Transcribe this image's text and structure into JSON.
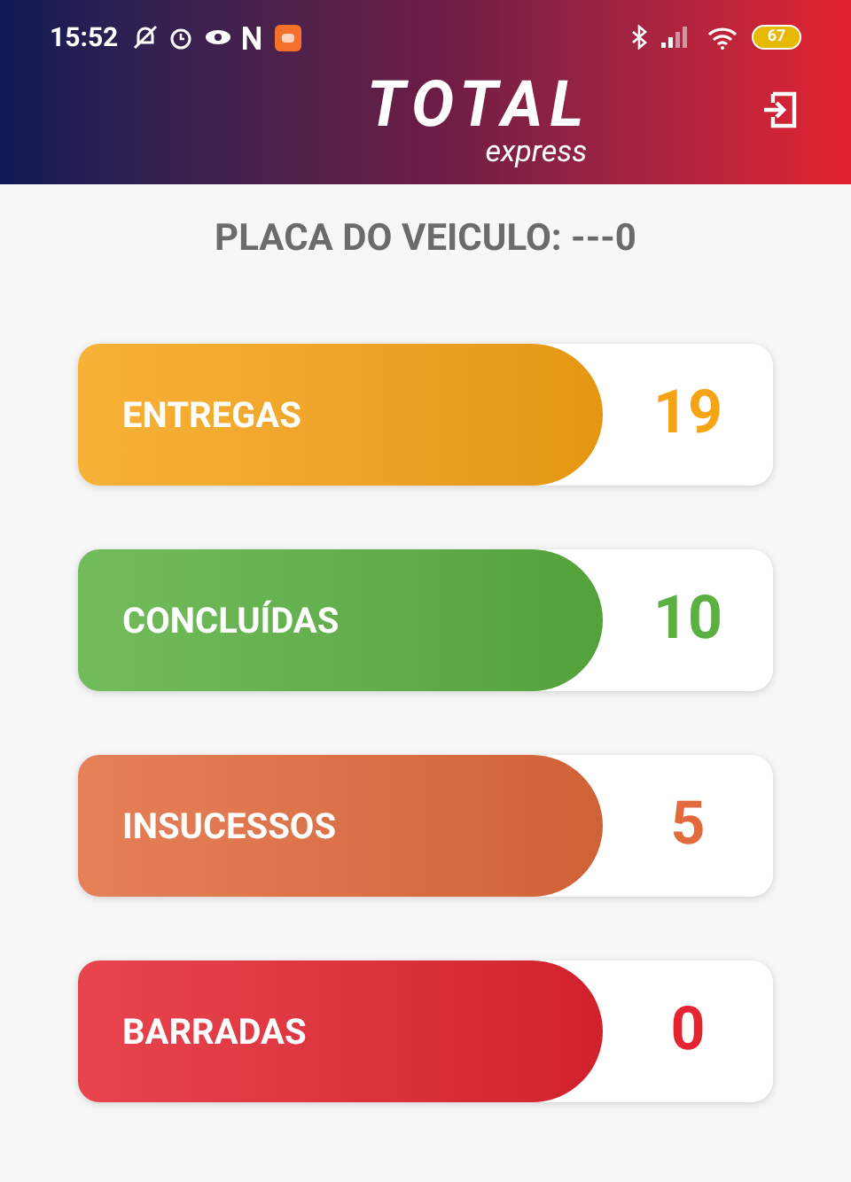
{
  "status_bar": {
    "time": "15:52",
    "battery": "67"
  },
  "header": {
    "logo": "TOTAL",
    "logo_sub": "express"
  },
  "plate": "PLACA DO VEICULO: ---0",
  "cards": [
    {
      "label": "ENTREGAS",
      "count": "19",
      "color": "#f7a414"
    },
    {
      "label": "CONCLUÍDAS",
      "count": "10",
      "color": "#5ab040"
    },
    {
      "label": "INSUCESSOS",
      "count": "5",
      "color": "#e26a3c"
    },
    {
      "label": "BARRADAS",
      "count": "0",
      "color": "#e42430"
    }
  ]
}
